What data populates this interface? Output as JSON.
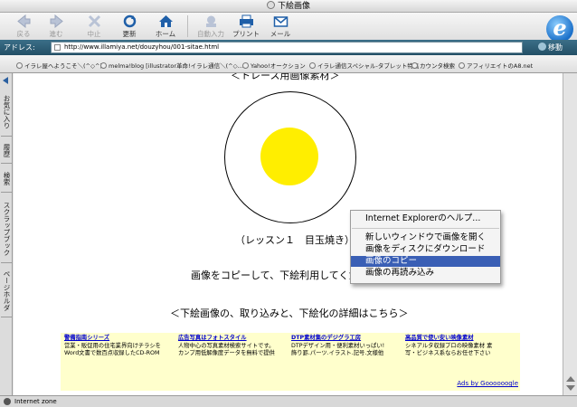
{
  "window": {
    "title": "下絵画像"
  },
  "toolbar": {
    "buttons": [
      {
        "label": "戻る",
        "enabled": false
      },
      {
        "label": "進む",
        "enabled": false
      },
      {
        "label": "中止",
        "enabled": false
      },
      {
        "label": "更新",
        "enabled": true
      },
      {
        "label": "ホーム",
        "enabled": true
      },
      {
        "label": "自動入力",
        "enabled": false
      },
      {
        "label": "プリント",
        "enabled": true
      },
      {
        "label": "メール",
        "enabled": true
      }
    ]
  },
  "address_bar": {
    "label": "アドレス:",
    "url": "http://www.illamiya.net/douzyhou/001-sitae.html",
    "go_label": "移動"
  },
  "favorites": [
    "イラレ屋へようこそ＼(^◇^)",
    "melma!blog [illustrator革命!イラレ通信＼(^◇...",
    "Yahoo!オークション",
    "イラレ通信スペシャル-タブレット特集",
    "カウンタ検索",
    "アフィリエイトのA8.net"
  ],
  "sidebar": {
    "tabs": [
      "お気に入り",
      "履歴",
      "検索",
      "スクラップブック",
      "ページホルダ"
    ]
  },
  "content": {
    "cut_title": "＜トレース用画像素材＞",
    "lesson": "（レッスン１　目玉焼き）",
    "copy_text": "画像をコピーして、下絵利用してください。",
    "detail_link": "＜下絵画像の、取り込みと、下絵化の詳細はこちら＞",
    "ads": [
      {
        "title": "警備指南シリーズ",
        "lines": [
          "営業・販促用の住宅業界向けチラシを",
          "Word文書で数百点収録したCD-ROM"
        ]
      },
      {
        "title": "広告写真はフォトスタイル",
        "lines": [
          "人物中心の写真素材検索サイトです。",
          "カンプ用低解像度データを無料で提供"
        ]
      },
      {
        "title": "DTP素材集のデジグラ工房",
        "lines": [
          "DTPデザイン用・便利素材いっぱい!",
          "飾り罫.パーツ.イラスト.記号.文様他"
        ]
      },
      {
        "title": "高品質で使い安い映像素材",
        "lines": [
          "シネアルタ収録プロの映像素材 素",
          "写・ビジネス系ならお任せ下さい"
        ]
      }
    ],
    "ads_by": "Ads by Goooooogle"
  },
  "context_menu": {
    "items": [
      {
        "label": "Internet Explorerのヘルプ...",
        "highlighted": false
      },
      {
        "label": "新しいウィンドウで画像を開く",
        "highlighted": false
      },
      {
        "label": "画像をディスクにダウンロード",
        "highlighted": false
      },
      {
        "label": "画像のコピー",
        "highlighted": true
      },
      {
        "label": "画像の再読み込み",
        "highlighted": false
      }
    ]
  },
  "status_bar": {
    "zone": "Internet zone"
  },
  "colors": {
    "accent": "#3a5fb5",
    "address_bar": "#2c5a72",
    "yolk": "#ffee00",
    "ads_bg": "#ffffcc",
    "link": "#0000cc"
  }
}
